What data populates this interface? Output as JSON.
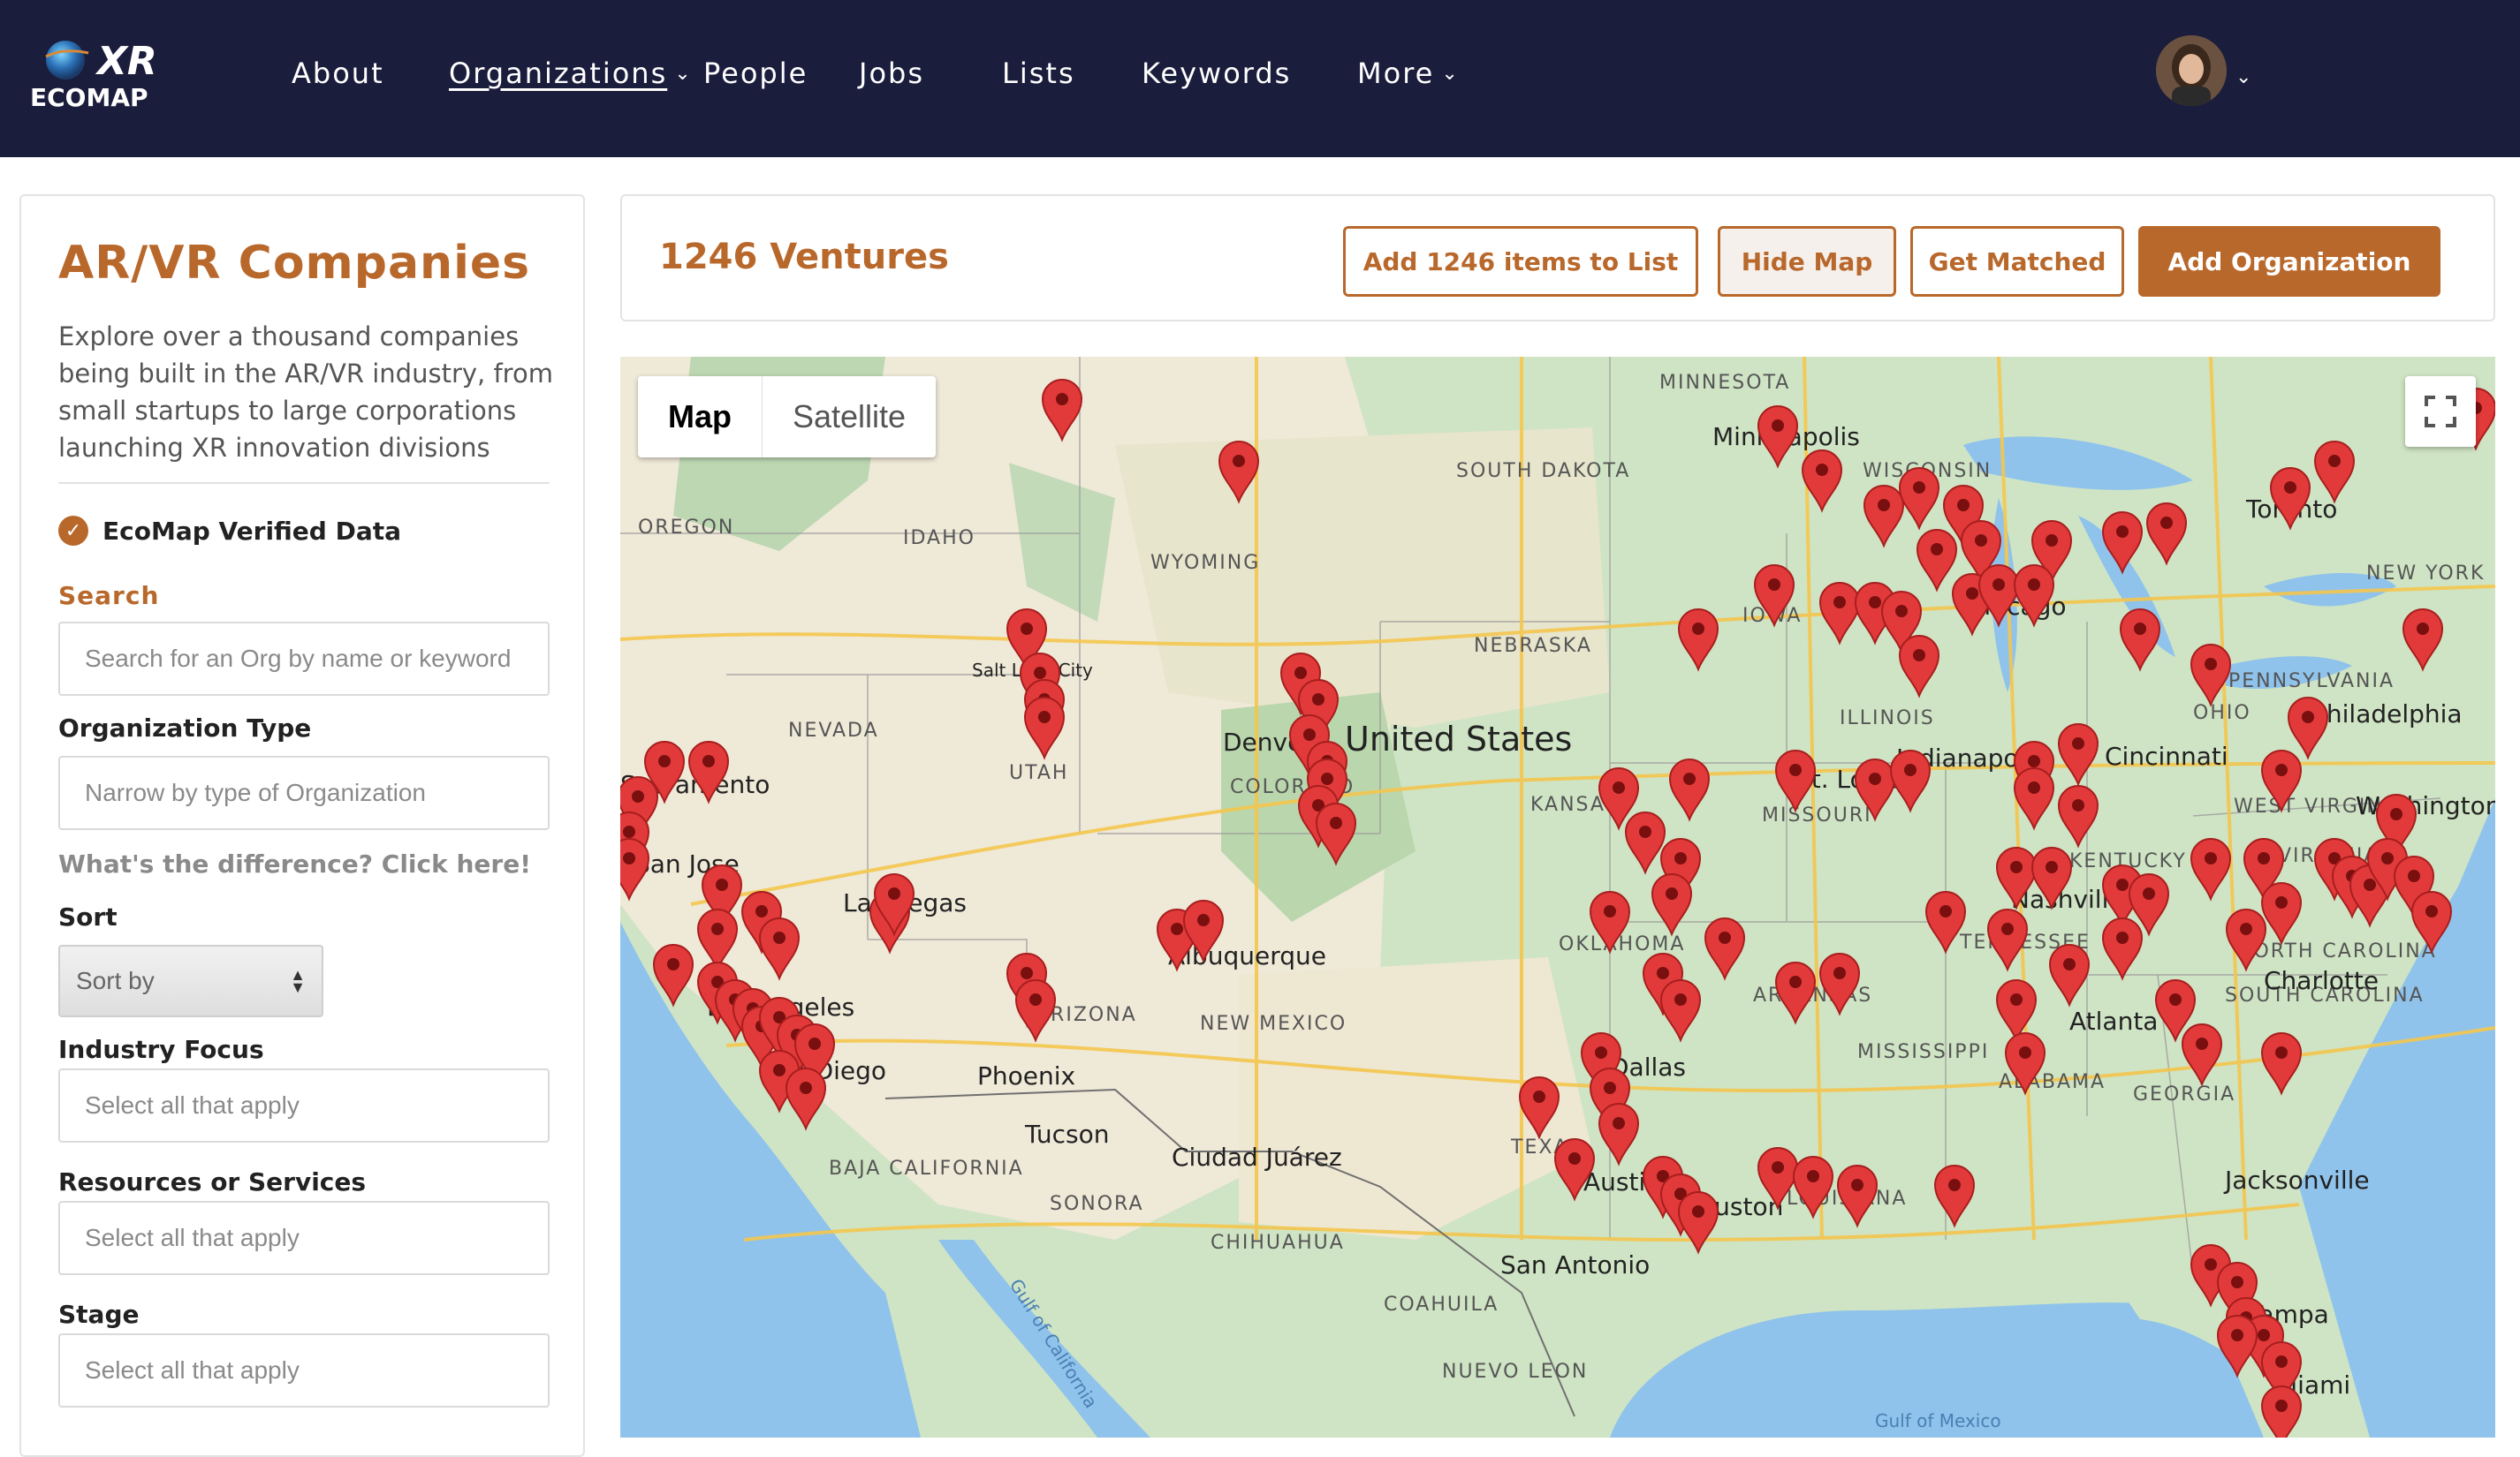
{
  "nav": {
    "logo_top": "XR",
    "logo_bottom": "ECOMAP",
    "links": {
      "about": "About",
      "organizations": "Organizations",
      "people": "People",
      "jobs": "Jobs",
      "lists": "Lists",
      "keywords": "Keywords",
      "more": "More"
    },
    "icons": {
      "dropdown": "chevron-down-icon"
    }
  },
  "sidebar": {
    "title": "AR/VR Companies",
    "description": "Explore over a thousand companies being built in the AR/VR industry, from small startups to large corporations launching XR innovation divisions",
    "verified_label": "EcoMap Verified Data",
    "search_label": "Search",
    "search_placeholder": "Search for an Org by name or keyword",
    "org_type_label": "Organization Type",
    "org_type_placeholder": "Narrow by type of Organization",
    "difference_link": "What's the difference? Click here!",
    "sort_label": "Sort",
    "sort_value": "Sort by",
    "industry_label": "Industry Focus",
    "industry_placeholder": "Select all that apply",
    "resources_label": "Resources or Services",
    "resources_placeholder": "Select all that apply",
    "stage_label": "Stage",
    "stage_placeholder": "Select all that apply"
  },
  "topbar": {
    "count": "1246 Ventures",
    "add_list": "Add 1246 items to List",
    "hide_map": "Hide Map",
    "get_matched": "Get Matched",
    "add_org": "Add Organization"
  },
  "map": {
    "toggle_map": "Map",
    "toggle_satellite": "Satellite",
    "country_label": "United States",
    "cities": [
      "Minneapolis",
      "Salt Lake City",
      "Denver",
      "Las Vegas",
      "San Jose",
      "Albuquerque",
      "Phoenix",
      "Tucson",
      "San Diego",
      "Ciudad Juárez",
      "San Antonio",
      "Austin",
      "Houston",
      "Dallas",
      "St. Louis",
      "Indianapolis",
      "Cincinnati",
      "Chicago",
      "Toronto",
      "Nashville",
      "Atlanta",
      "Charlotte",
      "Jacksonville",
      "Tampa",
      "Miami",
      "Philadelphia",
      "Washington",
      "Sacramento",
      "Los Angeles"
    ],
    "region_labels": [
      "OREGON",
      "IDAHO",
      "WYOMING",
      "SOUTH DAKOTA",
      "NEBRASKA",
      "IOWA",
      "ILLINOIS",
      "NEVADA",
      "UTAH",
      "COLORADO",
      "KANSAS",
      "MISSOURI",
      "OKLAHOMA",
      "ARKANSAS",
      "TENNESSEE",
      "KENTUCKY",
      "OHIO",
      "WISCONSIN",
      "PENNSYLVANIA",
      "WEST VIRGINIA",
      "VIRGINIA",
      "NORTH CAROLINA",
      "SOUTH CAROLINA",
      "GEORGIA",
      "ALABAMA",
      "MISSISSIPPI",
      "LOUISIANA",
      "TEXAS",
      "NEW MEXICO",
      "ARIZONA",
      "BAJA CALIFORNIA",
      "SONORA",
      "CHIHUAHUA",
      "COAHUILA",
      "NUEVO LEON",
      "NEW YORK",
      "MINNESOTA"
    ],
    "water_labels": [
      "Gulf of California",
      "Gulf of Mexico"
    ],
    "icons": {
      "fullscreen": "fullscreen-icon",
      "marker": "map-marker-icon"
    },
    "colors": {
      "land": "#cfe4c4",
      "land_dry": "#efe9d8",
      "water": "#8fc3ec",
      "marker": "#e23a3a",
      "road": "#f4c64e"
    }
  },
  "colors": {
    "nav_bg": "#1b1d3d",
    "accent": "#b9682b"
  }
}
